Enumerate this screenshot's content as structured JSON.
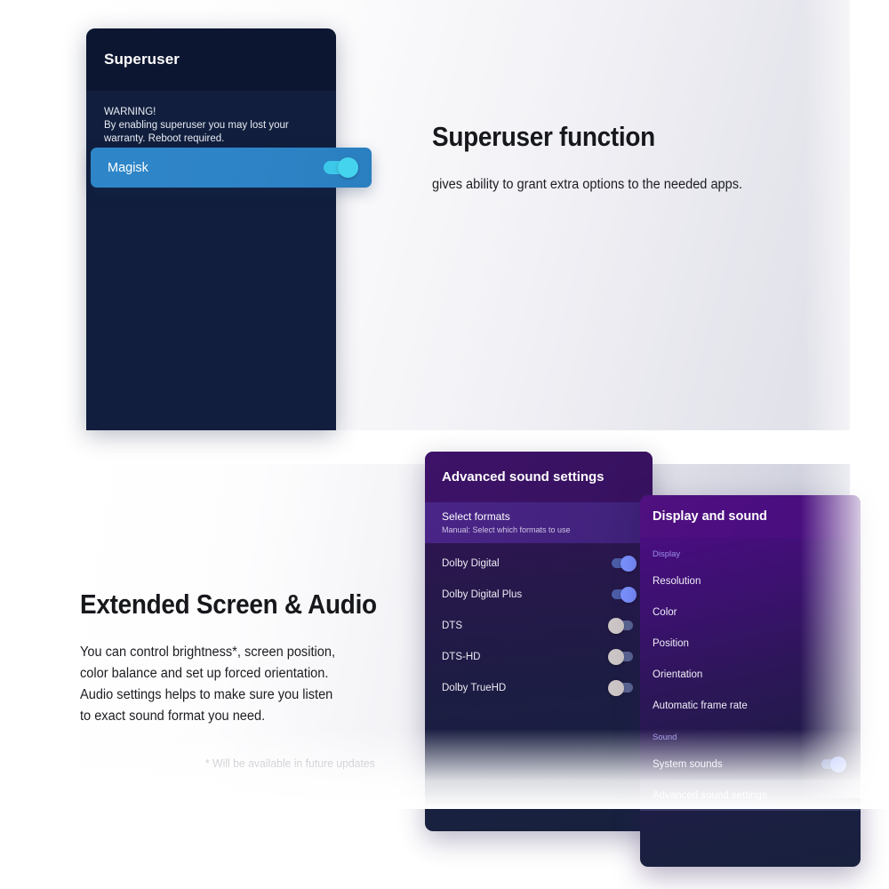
{
  "section1": {
    "card": {
      "title": "Superuser",
      "warning_line1": "WARNING!",
      "warning_line2": "By enabling superuser you may lost your",
      "warning_line3": "warranty. Reboot required.",
      "row_label": "Magisk",
      "row_toggle_state": "on"
    },
    "heading": "Superuser function",
    "body": "gives ability to grant extra options to the needed apps."
  },
  "section2": {
    "heading": "Extended Screen & Audio",
    "body_line1": "You can control brightness*, screen position,",
    "body_line2": "color balance and set up forced orientation.",
    "body_line3": "Audio settings helps to make sure you listen",
    "body_line4": "to exact sound format you need.",
    "footnote": "* Will be available in future updates",
    "sound_panel": {
      "title": "Advanced sound settings",
      "selected_row_title": "Select formats",
      "selected_row_subtitle": "Manual: Select which formats to use",
      "rows": [
        {
          "label": "Dolby Digital",
          "state": "on"
        },
        {
          "label": "Dolby Digital Plus",
          "state": "on"
        },
        {
          "label": "DTS",
          "state": "off"
        },
        {
          "label": "DTS-HD",
          "state": "off"
        },
        {
          "label": "Dolby TrueHD",
          "state": "off"
        }
      ]
    },
    "display_panel": {
      "title": "Display and sound",
      "section_display": "Display",
      "display_rows": [
        {
          "label": "Resolution"
        },
        {
          "label": "Color"
        },
        {
          "label": "Position"
        },
        {
          "label": "Orientation"
        },
        {
          "label": "Automatic frame rate"
        }
      ],
      "section_sound": "Sound",
      "sound_row": {
        "label": "System sounds",
        "state": "on"
      },
      "active_row": {
        "label": "Advanced sound settings"
      }
    }
  },
  "colors": {
    "card_bg": "#111e3d",
    "card_header_bg": "#0d1631",
    "magisk_blue": "#2e86c8",
    "toggle_on_cyan": "#45d4ee",
    "toggle_on_blue": "#7b92ff",
    "toggle_off_gray": "#cdc6c6",
    "purple_header": "#4b0e80",
    "accent_lavender": "#9b8fe8"
  }
}
